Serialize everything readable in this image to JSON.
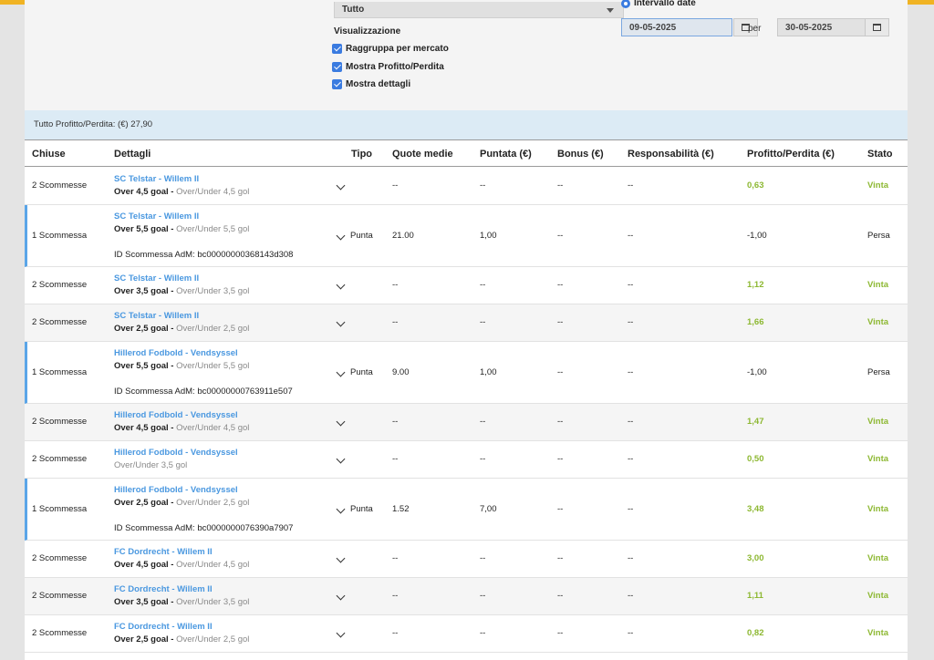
{
  "filters": {
    "select_value": "Tutto",
    "visualizzazione_label": "Visualizzazione",
    "checks": [
      "Raggruppa per mercato",
      "Mostra Profitto/Perdita",
      "Mostra dettagli"
    ],
    "radio_label": "Intervallo date",
    "date_from": "09-05-2025",
    "per_label": "per",
    "date_to": "30-05-2025"
  },
  "summary": "Tutto Profitto/Perdita: (€) 27,90",
  "columns": {
    "chiuse": "Chiuse",
    "dettagli": "Dettagli",
    "tipo": "Tipo",
    "quote": "Quote medie",
    "puntata": "Puntata (€)",
    "bonus": "Bonus (€)",
    "resp": "Responsabilità (€)",
    "pl": "Profitto/Perdita (€)",
    "stato": "Stato"
  },
  "rows": [
    {
      "chiuse": "2 Scommesse",
      "event": "SC Telstar - Willem II",
      "market": "Over 4,5 goal",
      "sep": " - ",
      "sub": "Over/Under 4,5 gol",
      "tipo": "",
      "quote": "--",
      "puntata": "--",
      "bonus": "--",
      "resp": "--",
      "pl": "0,63",
      "stato": "Vinta"
    },
    {
      "chiuse": "1 Scommessa",
      "event": "SC Telstar - Willem II",
      "market": "Over 5,5 goal",
      "sep": " - ",
      "sub": "Over/Under 5,5 gol",
      "betid": "ID Scommessa AdM: bc00000000368143d308",
      "tipo": "Punta",
      "quote": "21.00",
      "puntata": "1,00",
      "bonus": "--",
      "resp": "--",
      "pl": "-1,00",
      "stato": "Persa"
    },
    {
      "chiuse": "2 Scommesse",
      "event": "SC Telstar - Willem II",
      "market": "Over 3,5 goal",
      "sep": " - ",
      "sub": "Over/Under 3,5 gol",
      "tipo": "",
      "quote": "--",
      "puntata": "--",
      "bonus": "--",
      "resp": "--",
      "pl": "1,12",
      "stato": "Vinta"
    },
    {
      "chiuse": "2 Scommesse",
      "event": "SC Telstar - Willem II",
      "market": "Over 2,5 goal",
      "sep": " - ",
      "sub": "Over/Under 2,5 gol",
      "tipo": "",
      "quote": "--",
      "puntata": "--",
      "bonus": "--",
      "resp": "--",
      "pl": "1,66",
      "stato": "Vinta"
    },
    {
      "chiuse": "1 Scommessa",
      "event": "Hillerod Fodbold - Vendsyssel",
      "market": "Over 5,5 goal",
      "sep": " - ",
      "sub": "Over/Under 5,5 gol",
      "betid": "ID Scommessa AdM: bc00000000763911e507",
      "tipo": "Punta",
      "quote": "9.00",
      "puntata": "1,00",
      "bonus": "--",
      "resp": "--",
      "pl": "-1,00",
      "stato": "Persa"
    },
    {
      "chiuse": "2 Scommesse",
      "event": "Hillerod Fodbold - Vendsyssel",
      "market": "Over 4,5 goal",
      "sep": " - ",
      "sub": "Over/Under 4,5 gol",
      "tipo": "",
      "quote": "--",
      "puntata": "--",
      "bonus": "--",
      "resp": "--",
      "pl": "1,47",
      "stato": "Vinta"
    },
    {
      "chiuse": "2 Scommesse",
      "event": "Hillerod Fodbold - Vendsyssel",
      "market": "",
      "sep": "",
      "sub": "Over/Under 3,5 gol",
      "tipo": "",
      "quote": "--",
      "puntata": "--",
      "bonus": "--",
      "resp": "--",
      "pl": "0,50",
      "stato": "Vinta"
    },
    {
      "chiuse": "1 Scommessa",
      "event": "Hillerod Fodbold - Vendsyssel",
      "market": "Over 2,5 goal",
      "sep": " - ",
      "sub": "Over/Under 2,5 gol",
      "betid": "ID Scommessa AdM: bc0000000076390a7907",
      "tipo": "Punta",
      "quote": "1.52",
      "puntata": "7,00",
      "bonus": "--",
      "resp": "--",
      "pl": "3,48",
      "stato": "Vinta"
    },
    {
      "chiuse": "2 Scommesse",
      "event": "FC Dordrecht - Willem II",
      "market": "Over 4,5 goal",
      "sep": " - ",
      "sub": "Over/Under 4,5 gol",
      "tipo": "",
      "quote": "--",
      "puntata": "--",
      "bonus": "--",
      "resp": "--",
      "pl": "3,00",
      "stato": "Vinta"
    },
    {
      "chiuse": "2 Scommesse",
      "event": "FC Dordrecht - Willem II",
      "market": "Over 3,5 goal",
      "sep": " - ",
      "sub": "Over/Under 3,5 gol",
      "tipo": "",
      "quote": "--",
      "puntata": "--",
      "bonus": "--",
      "resp": "--",
      "pl": "1,11",
      "stato": "Vinta"
    },
    {
      "chiuse": "2 Scommesse",
      "event": "FC Dordrecht - Willem II",
      "market": "Over 2,5 goal",
      "sep": " - ",
      "sub": "Over/Under 2,5 gol",
      "tipo": "",
      "quote": "--",
      "puntata": "--",
      "bonus": "--",
      "resp": "--",
      "pl": "0,82",
      "stato": "Vinta"
    }
  ],
  "colors": {
    "accent": "#3a7be0",
    "win": "#8db832",
    "link": "#4a98e0",
    "summary_bg": "#dcebf5",
    "top_bar": "#f0b323"
  }
}
